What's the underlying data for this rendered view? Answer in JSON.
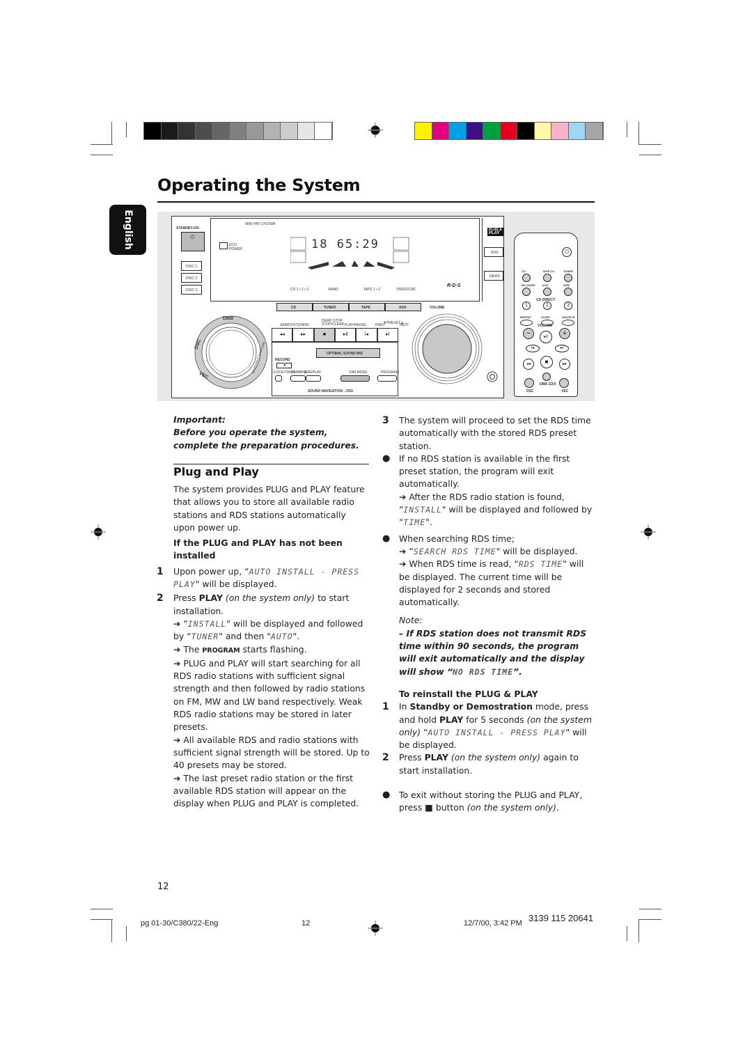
{
  "print_marks": {
    "grayscale_swatches": [
      "#000000",
      "#1a1a1a",
      "#333333",
      "#4d4d4d",
      "#666666",
      "#808080",
      "#999999",
      "#b3b3b3",
      "#cccccc",
      "#e6e6e6",
      "#ffffff"
    ],
    "color_swatches": [
      "#fff200",
      "#e4007f",
      "#00a0e9",
      "#3d0f82",
      "#00a040",
      "#e60020",
      "#000000",
      "#fff9a8",
      "#f7b1c8",
      "#9dd6f6",
      "#a6a6a6"
    ]
  },
  "page": {
    "title": "Operating the System",
    "language_tab": "English",
    "page_number": "12"
  },
  "figure": {
    "unit": {
      "brand_text": "MINI HIFI SYSTEM",
      "standby_label": "STANDBY-ON",
      "eco_label_1": "ECO",
      "eco_label_2": "POWER",
      "disc_buttons": [
        "DISC 1",
        "DISC 2",
        "DISC 3"
      ],
      "display_digits": "18  65:29",
      "source_labels": [
        "CD 1 • 2 • 3",
        "BAND",
        "TAPE 1 • 2",
        "VIDEO/CDR"
      ],
      "source_buttons": [
        "CD",
        "TUNER",
        "TAPE",
        "AUX"
      ],
      "transport_labels": [
        "SEARCH•TUNING",
        "DEMO STOP\nSTOP•CLEAR",
        "PLAY•PAUSE",
        "PREV",
        "▼PRESET▲",
        "NEXT"
      ],
      "transport_icons": [
        "◂◂",
        "▸▸",
        "■",
        "▸ll",
        "l◂",
        "▸l"
      ],
      "optimal_sound": "OPTIMAL SOUND MIX",
      "record_label": "RECORD",
      "lower_labels": [
        "CLOCK•TIMER",
        "DUBBING",
        "A.REPLAY",
        "DIM MODE",
        "PROGRAM"
      ],
      "jog_label": "SOUND NAVIGATION - JOG",
      "volume_label": "VOLUME",
      "dial_segments": [
        "DBB",
        "DSC",
        "VEC",
        "INCREDIBLE SURROUND"
      ],
      "logo": "R·D·S",
      "plug_play_badge_1": "PLUG &",
      "plug_play_badge_2": "PLAY",
      "side_buttons": [
        "RDS",
        "NEWS"
      ]
    },
    "remote": {
      "row1": [
        "CD",
        "TAPE 1/2",
        "TUNER"
      ],
      "row2": [
        "INC.SURR.",
        "AUX",
        "DSM"
      ],
      "cd_direct": "CD DIRECT",
      "digits": [
        "1",
        "2",
        "3"
      ],
      "row4": [
        "REPEAT",
        "SLEEP",
        "SHUFFLE"
      ],
      "volume": "VOLUME",
      "vol_minus": "−",
      "vol_plus": "+",
      "play_pause": "▸ll",
      "prev": "l◂",
      "next": "▸l",
      "rew": "◂◂",
      "stop": "■",
      "ffw": "▸▸",
      "bottom": [
        "DSC",
        "DBB 1/2/3",
        "VEC"
      ]
    }
  },
  "left_column": {
    "important_label": "Important:",
    "important_text": "Before you operate the system, complete the preparation procedures.",
    "section_title": "Plug and Play",
    "intro": "The system provides PLUG and PLAY feature that allows you to store all available radio stations and RDS stations automatically upon power up.",
    "subheading": "If the PLUG and PLAY has not been installed",
    "step1_num": "1",
    "step1_a": "Upon power up, “",
    "step1_lcd": "AUTO INSTALL - PRESS PLAY",
    "step1_b": "\" will be displayed.",
    "step2_num": "2",
    "step2_a": "Press ",
    "step2_bold": "PLAY",
    "step2_italic": " (on the system only)",
    "step2_b": " to start installation.",
    "arrow1_a": "➔ “",
    "arrow1_lcd1": "INSTALL",
    "arrow1_b": "\" will be displayed and followed by “",
    "arrow1_lcd2": "TUNER",
    "arrow1_c": "\" and then \"",
    "arrow1_lcd3": "AUTO",
    "arrow1_d": "\".",
    "arrow2_a": "➔ The ",
    "arrow2_bold": "PROGRAM",
    "arrow2_b": " starts flashing.",
    "arrow3": "➔ PLUG and PLAY will start searching for all RDS radio stations with sufficient signal strength and then followed by radio stations on FM, MW and LW band respectively. Weak RDS radio stations may be stored in later presets.",
    "arrow4": "➔ All available RDS and radio stations with sufficient signal strength will be stored. Up to 40 presets may be stored.",
    "arrow5": "➔ The last preset radio station or the first available RDS station will appear on the display when PLUG and PLAY is completed."
  },
  "right_column": {
    "step3_num": "3",
    "step3": "The system will proceed to set the RDS time automatically with the stored RDS preset station.",
    "bullet1": "If no RDS station is available in the first preset station, the program will exit automatically.",
    "bullet1_arrow_a": "➔ After the RDS radio station is found, “",
    "bullet1_lcd1": "INSTALL",
    "bullet1_arrow_b": "\" will be displayed and followed by “",
    "bullet1_lcd2": "TIME",
    "bullet1_arrow_c": "\".",
    "bullet2": "When searching RDS time;",
    "bullet2_arrow1_a": "➔ “",
    "bullet2_arrow1_lcd": "SEARCH RDS TIME",
    "bullet2_arrow1_b": "\" will be displayed.",
    "bullet2_arrow2_a": "➔ When RDS time is read, “",
    "bullet2_arrow2_lcd": "RDS TIME",
    "bullet2_arrow2_b": "\" will be displayed. The current time will be displayed for 2 seconds and stored automatically.",
    "note_label": "Note:",
    "note_a": "–  If RDS station does not transmit RDS time within 90 seconds, the program will exit automatically and the display will show “",
    "note_lcd": "NO RDS TIME",
    "note_b": "”.",
    "reinstall_heading": "To reinstall the PLUG & PLAY",
    "r1_num": "1",
    "r1_a": "In ",
    "r1_bold1": "Standby or Demostration",
    "r1_b": " mode, press and hold ",
    "r1_bold2": "PLAY",
    "r1_c": " for 5 seconds ",
    "r1_italic": "(on the system only)",
    "r1_d": " “",
    "r1_lcd": "AUTO INSTALL - PRESS PLAY",
    "r1_e": "\" will be displayed.",
    "r2_num": "2",
    "r2_a": "Press ",
    "r2_bold": "PLAY",
    "r2_italic": " (on the system only)",
    "r2_b": " again to start installation.",
    "bullet3_a": "To exit without storing the PLUG and PLAY, press ",
    "bullet3_icon": "■",
    "bullet3_b": " button ",
    "bullet3_italic": "(on the system only)",
    "bullet3_c": "."
  },
  "footer": {
    "file": "pg  01-30/C380/22-Eng",
    "page": "12",
    "timestamp": "12/7/00, 3:42 PM",
    "code": "3139 115 20641"
  }
}
